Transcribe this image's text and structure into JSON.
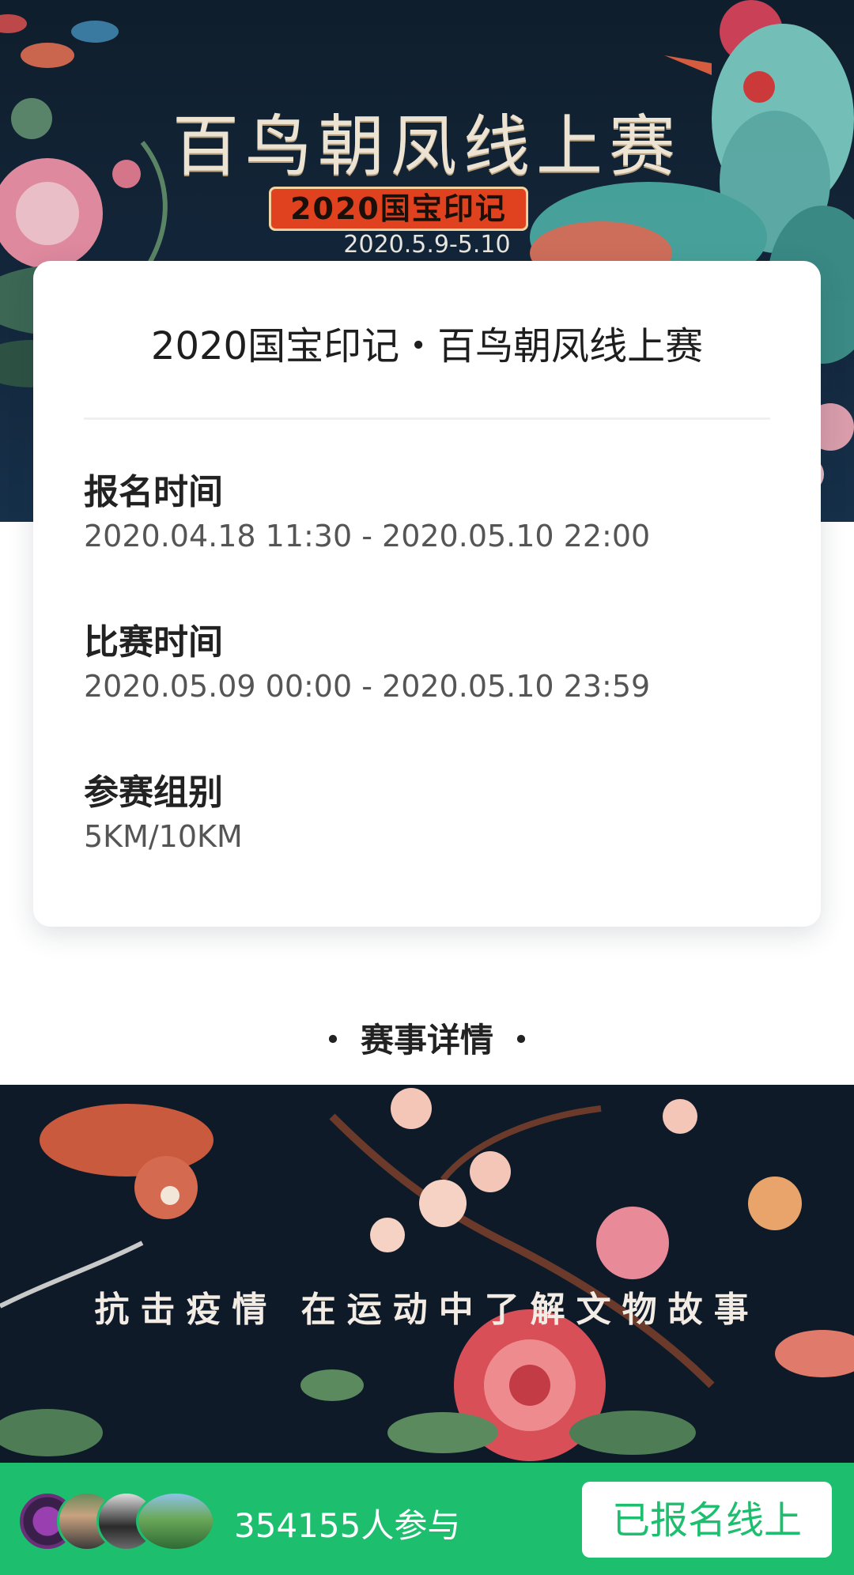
{
  "banner": {
    "title": "百鸟朝凤线上赛",
    "badge": "2020国宝印记",
    "date": "2020.5.9-5.10"
  },
  "card": {
    "title": "2020国宝印记・百鸟朝凤线上赛",
    "items": [
      {
        "label": "报名时间",
        "value": "2020.04.18 11:30 - 2020.05.10 22:00"
      },
      {
        "label": "比赛时间",
        "value": "2020.05.09 00:00 - 2020.05.10 23:59"
      },
      {
        "label": "参赛组别",
        "value": "5KM/10KM"
      }
    ]
  },
  "section": {
    "title": "赛事详情",
    "dot": "・"
  },
  "detail": {
    "slogan": "抗击疫情 在运动中了解文物故事"
  },
  "bottom_bar": {
    "participants": "354155人参与",
    "signup_label": "已报名线上",
    "accent_color": "#1dbf6f"
  }
}
